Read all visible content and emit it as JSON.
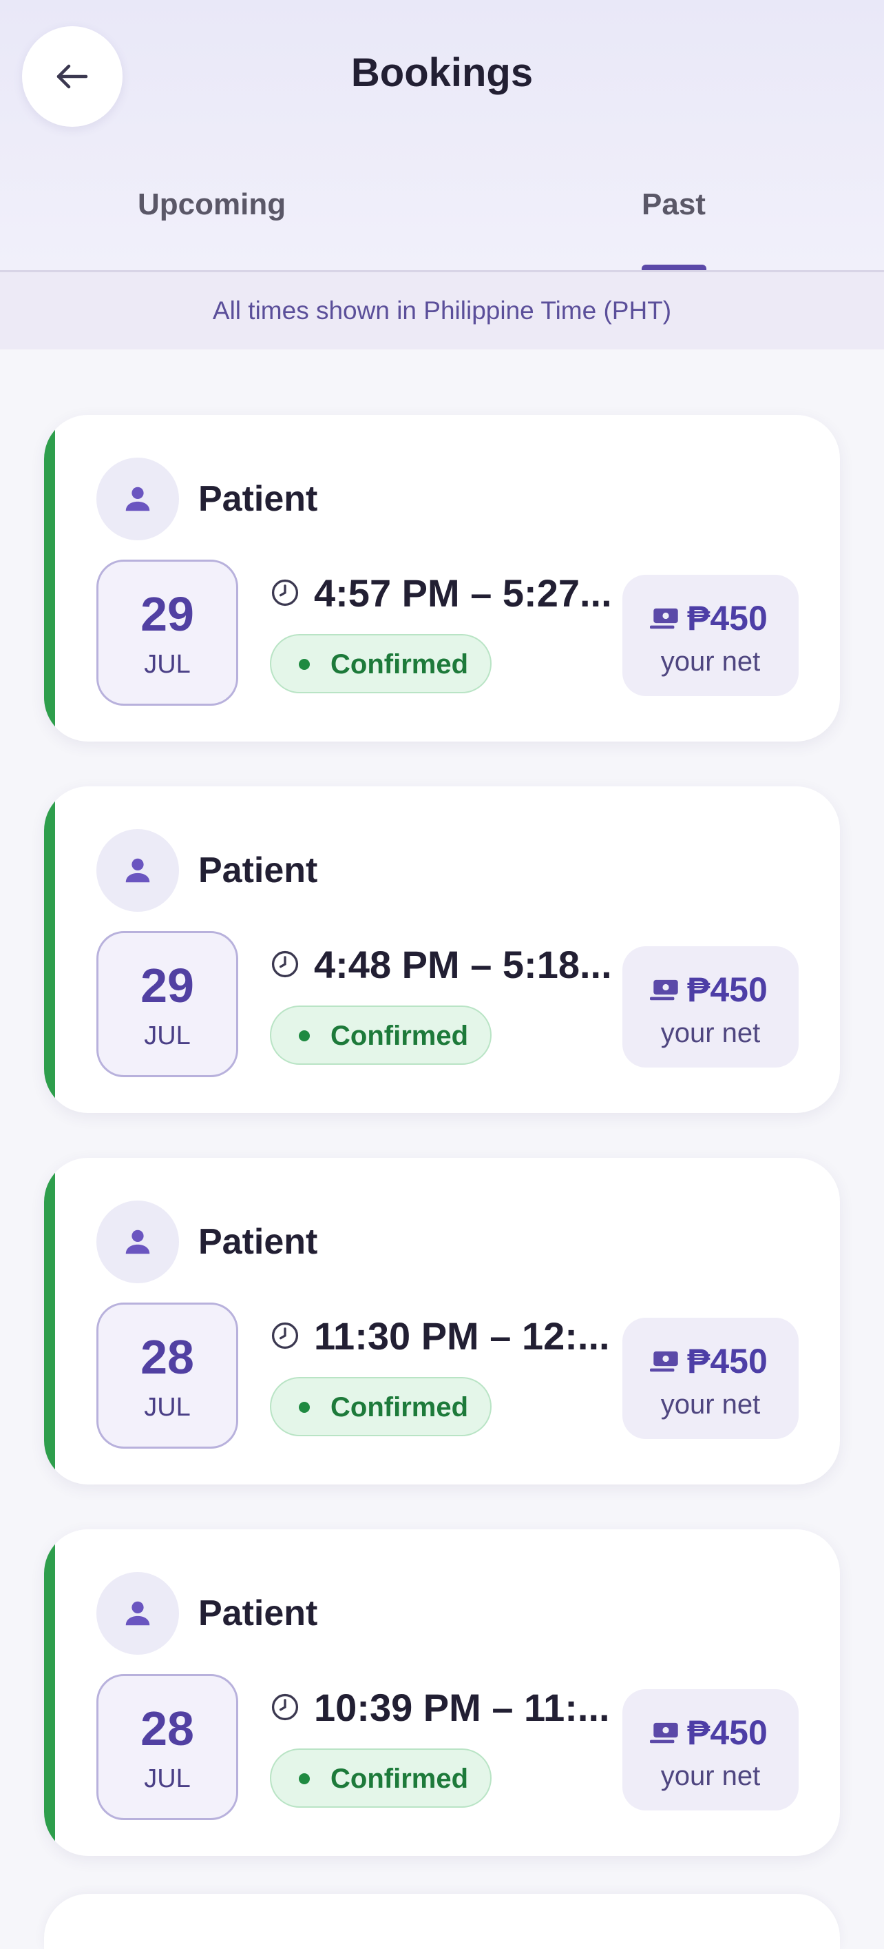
{
  "header": {
    "title": "Bookings",
    "back_icon": "arrow-left-icon"
  },
  "tabs": [
    {
      "label": "Upcoming",
      "active": false
    },
    {
      "label": "Past",
      "active": true
    }
  ],
  "timezone_notice": "All times shown in Philippine Time (PHT)",
  "colors": {
    "accent": "#5b49a8",
    "status_green": "#2e9e4c",
    "price_bg": "#efedf8"
  },
  "bookings": [
    {
      "patient": "Patient",
      "day": "29",
      "month": "JUL",
      "time": "4:57 PM – 5:27...",
      "status": "Confirmed",
      "price": "₱450",
      "price_note": "your net"
    },
    {
      "patient": "Patient",
      "day": "29",
      "month": "JUL",
      "time": "4:48 PM – 5:18...",
      "status": "Confirmed",
      "price": "₱450",
      "price_note": "your net"
    },
    {
      "patient": "Patient",
      "day": "28",
      "month": "JUL",
      "time": "11:30 PM – 12:...",
      "status": "Confirmed",
      "price": "₱450",
      "price_note": "your net"
    },
    {
      "patient": "Patient",
      "day": "28",
      "month": "JUL",
      "time": "10:39 PM – 11:...",
      "status": "Confirmed",
      "price": "₱450",
      "price_note": "your net"
    }
  ]
}
